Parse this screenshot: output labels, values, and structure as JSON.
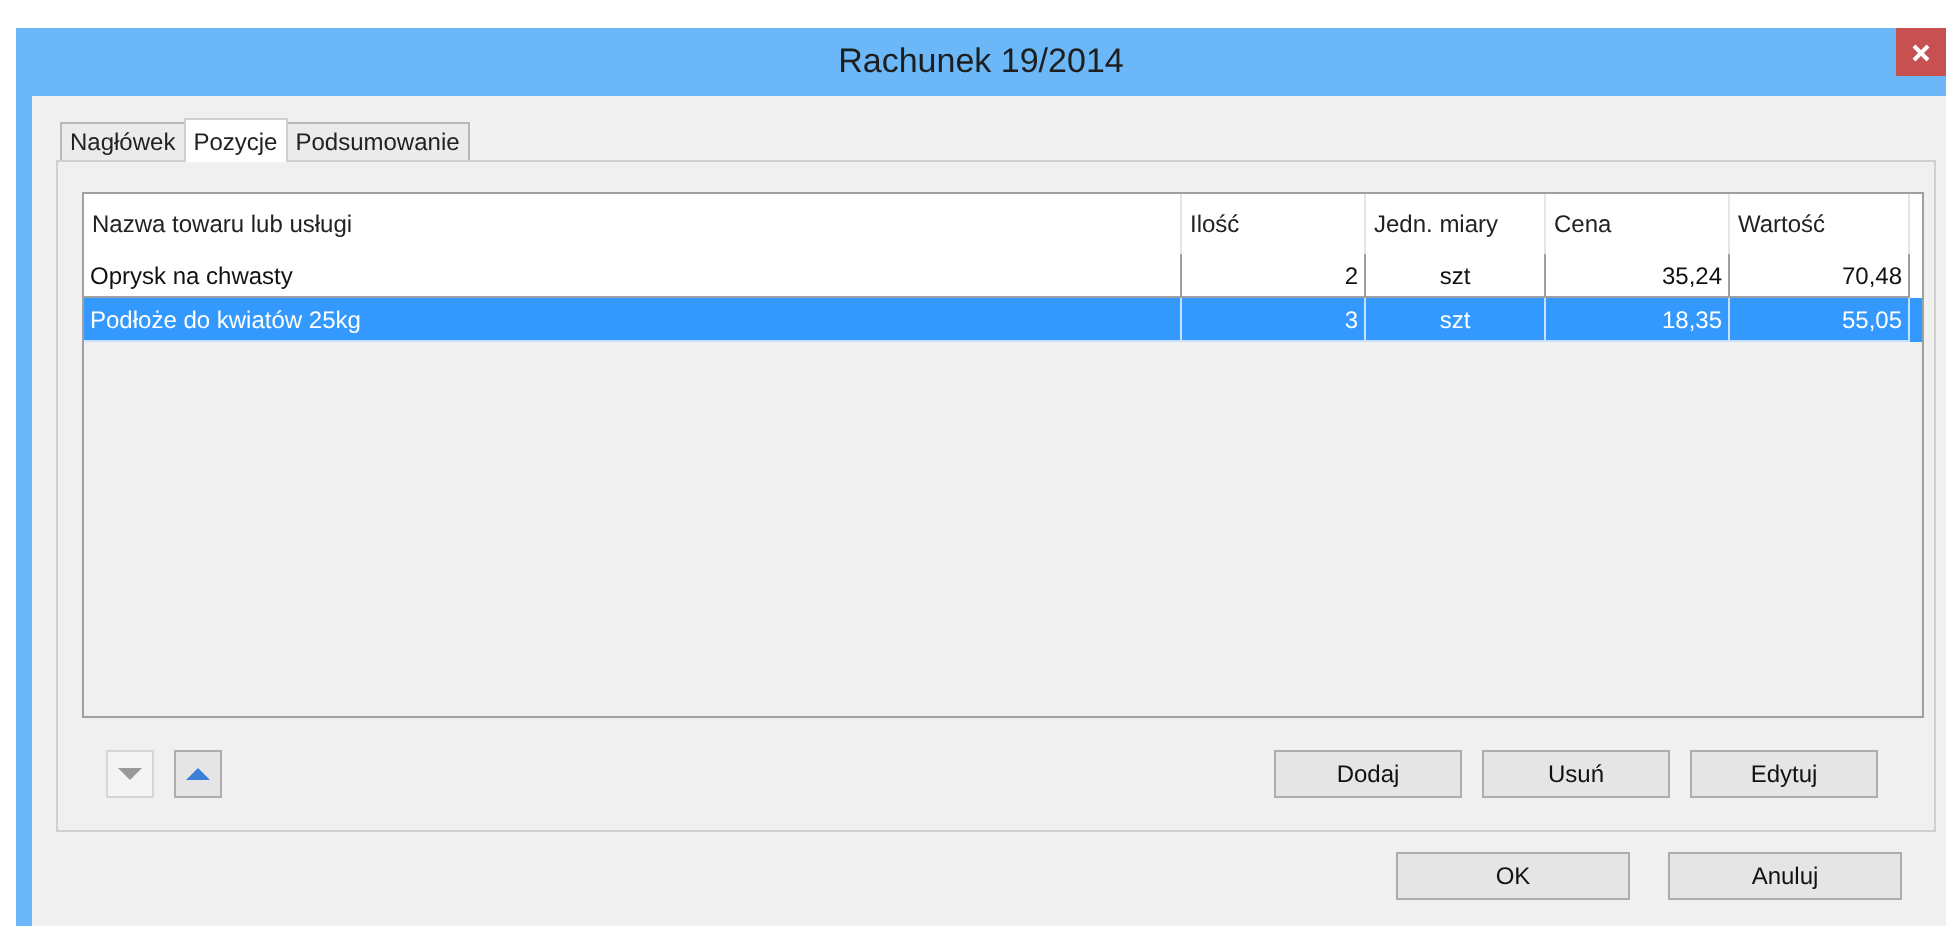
{
  "window": {
    "title": "Rachunek 19/2014"
  },
  "tabs": [
    {
      "label": "Nagłówek",
      "selected": false
    },
    {
      "label": "Pozycje",
      "selected": true
    },
    {
      "label": "Podsumowanie",
      "selected": false
    }
  ],
  "table": {
    "columns": [
      "Nazwa towaru lub usługi",
      "Ilość",
      "Jedn. miary",
      "Cena",
      "Wartość"
    ],
    "rows": [
      {
        "cells": [
          "Oprysk na chwasty",
          "2",
          "szt",
          "35,24",
          "70,48"
        ],
        "selected": false
      },
      {
        "cells": [
          "Podłoże do kwiatów 25kg",
          "3",
          "szt",
          "18,35",
          "55,05"
        ],
        "selected": true
      }
    ]
  },
  "move_buttons": [
    {
      "kind": "down",
      "disabled": true
    },
    {
      "kind": "up",
      "disabled": false
    }
  ],
  "row_buttons": [
    "Dodaj",
    "Usuń",
    "Edytuj"
  ],
  "dialog_buttons": [
    "OK",
    "Anuluj"
  ]
}
